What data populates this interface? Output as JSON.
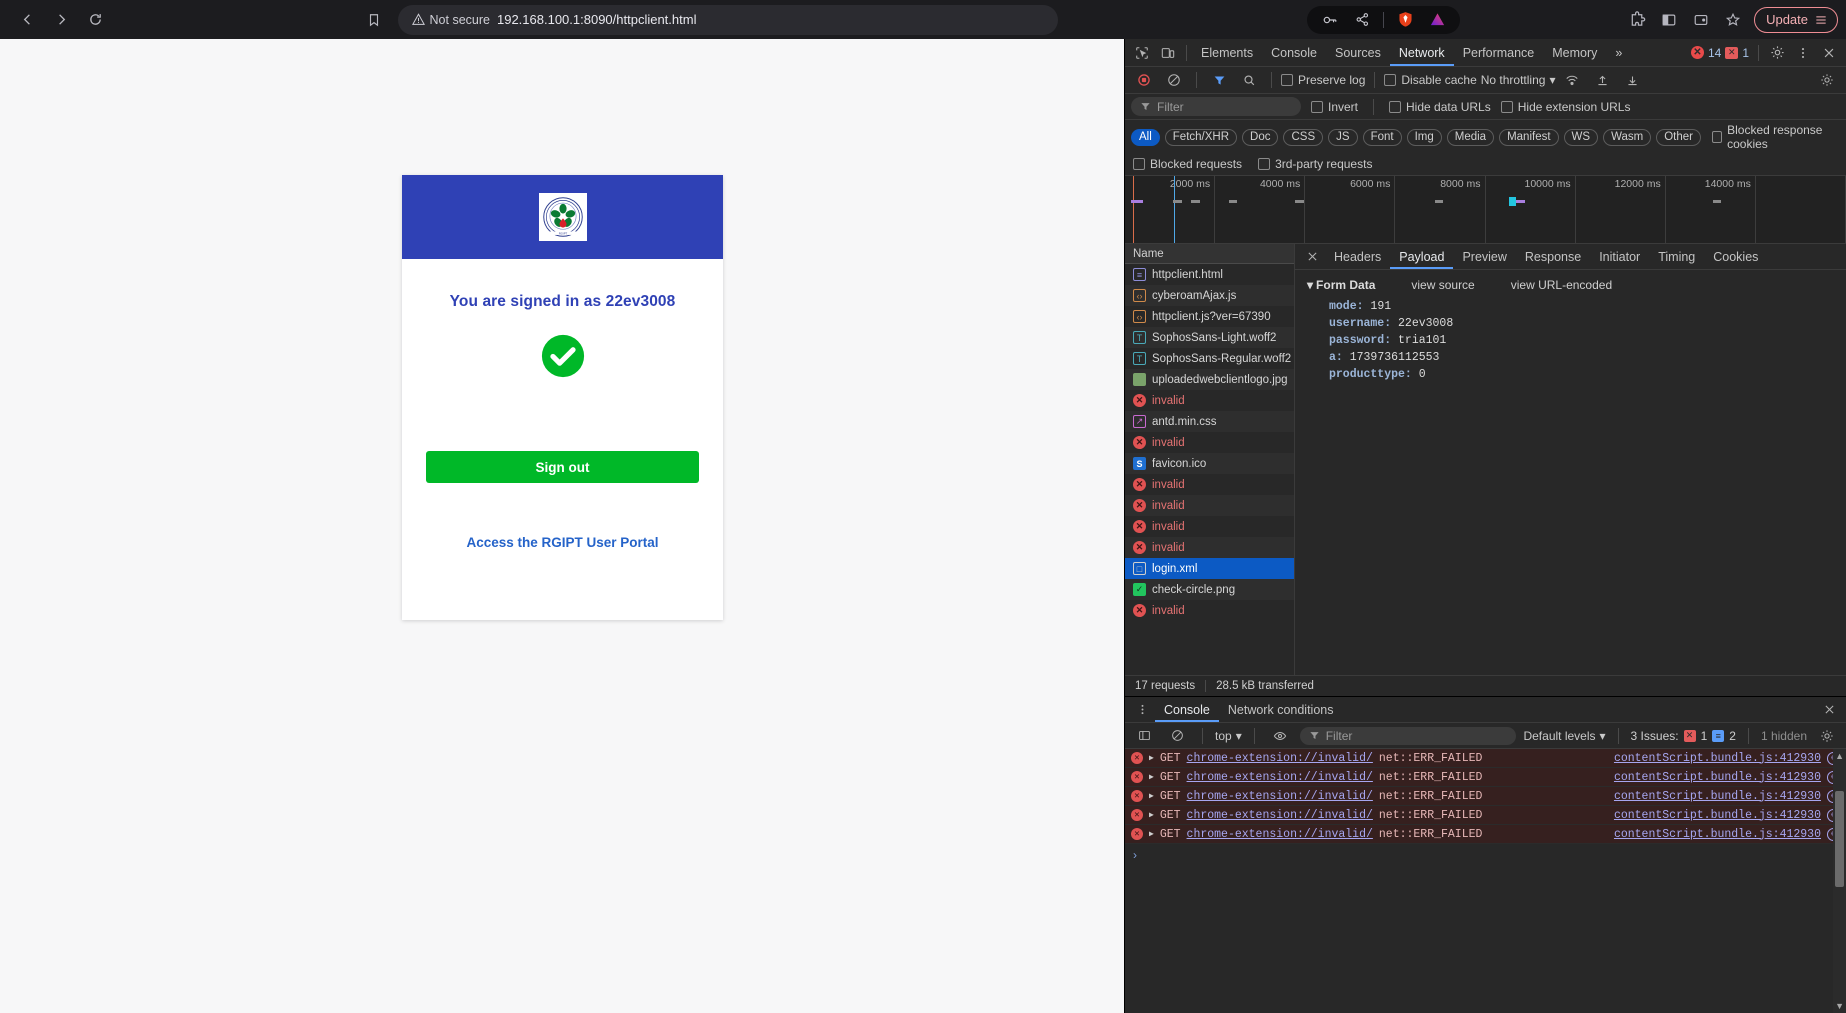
{
  "browser": {
    "back_icon": "back-arrow-icon",
    "forward_icon": "forward-arrow-icon",
    "reload_icon": "reload-icon",
    "bookmark_icon": "bookmark-icon",
    "security_label": "Not secure",
    "url": "192.168.100.1:8090/httpclient.html",
    "update_label": "Update",
    "toolbar_icons": [
      "password-key-icon",
      "share-icon",
      "brave-shield-icon",
      "leo-ai-icon",
      "extensions-icon",
      "sidebar-icon",
      "wallet-icon",
      "bookmark-star-icon",
      "menu-icon"
    ]
  },
  "page": {
    "signed_in_text": "You are signed in as 22ev3008",
    "signout_label": "Sign out",
    "portal_link": "Access the RGIPT User Portal",
    "logo_name": "rgipt-logo",
    "header_color": "#2f41b5",
    "button_color": "#00b828",
    "link_color": "#2563c9"
  },
  "devtools": {
    "tabs": [
      {
        "label": "Elements",
        "active": false
      },
      {
        "label": "Console",
        "active": false
      },
      {
        "label": "Sources",
        "active": false
      },
      {
        "label": "Network",
        "active": true
      },
      {
        "label": "Performance",
        "active": false
      },
      {
        "label": "Memory",
        "active": false
      }
    ],
    "more_tabs": "»",
    "error_count": "14",
    "warning_count": "1",
    "settings_icon": "gear-icon",
    "more_icon": "kebab-menu-icon",
    "close_icon": "close-icon",
    "inspect_icon": "inspect-element-icon",
    "device_icon": "device-toolbar-icon",
    "network": {
      "record_icon": "record-stop-icon",
      "clear_icon": "clear-requests-icon",
      "filter_icon": "filter-icon",
      "search_icon": "search-icon",
      "preserve_log": "Preserve log",
      "disable_cache": "Disable cache",
      "throttling": "No throttling",
      "wifi_icon": "network-conditions-icon",
      "import_icon": "import-har-icon",
      "export_icon": "export-har-icon",
      "settings_icon": "network-settings-icon",
      "filter_placeholder": "Filter",
      "invert": "Invert",
      "hide_data_urls": "Hide data URLs",
      "hide_extension_urls": "Hide extension URLs",
      "types": [
        "All",
        "Fetch/XHR",
        "Doc",
        "CSS",
        "JS",
        "Font",
        "Img",
        "Media",
        "Manifest",
        "WS",
        "Wasm",
        "Other"
      ],
      "active_type": "All",
      "blocked_response_cookies": "Blocked response cookies",
      "blocked_requests": "Blocked requests",
      "third_party_requests": "3rd-party requests",
      "timeline_ticks": [
        "2000 ms",
        "4000 ms",
        "6000 ms",
        "8000 ms",
        "10000 ms",
        "12000 ms",
        "14000 ms"
      ],
      "name_column": "Name",
      "requests": [
        {
          "name": "httpclient.html",
          "kind": "html",
          "glyph": "≡"
        },
        {
          "name": "cyberoamAjax.js",
          "kind": "js",
          "glyph": "‹›"
        },
        {
          "name": "httpclient.js?ver=67390",
          "kind": "js",
          "glyph": "‹›"
        },
        {
          "name": "SophosSans-Light.woff2",
          "kind": "font",
          "glyph": "T"
        },
        {
          "name": "SophosSans-Regular.woff2",
          "kind": "font",
          "glyph": "T"
        },
        {
          "name": "uploadedwebclientlogo.jpg",
          "kind": "img",
          "glyph": ""
        },
        {
          "name": "invalid",
          "kind": "err",
          "glyph": "✕"
        },
        {
          "name": "antd.min.css",
          "kind": "css",
          "glyph": "↗"
        },
        {
          "name": "invalid",
          "kind": "err",
          "glyph": "✕"
        },
        {
          "name": "favicon.ico",
          "kind": "ico",
          "glyph": "S"
        },
        {
          "name": "invalid",
          "kind": "err",
          "glyph": "✕"
        },
        {
          "name": "invalid",
          "kind": "err",
          "glyph": "✕"
        },
        {
          "name": "invalid",
          "kind": "err",
          "glyph": "✕"
        },
        {
          "name": "invalid",
          "kind": "err",
          "glyph": "✕"
        },
        {
          "name": "login.xml",
          "kind": "xml",
          "glyph": "□",
          "selected": true
        },
        {
          "name": "check-circle.png",
          "kind": "png",
          "glyph": "✓"
        },
        {
          "name": "invalid",
          "kind": "err",
          "glyph": "✕"
        }
      ],
      "status_requests": "17 requests",
      "status_transferred": "28.5 kB transferred"
    },
    "detail": {
      "close_icon": "close-detail-icon",
      "tabs": [
        {
          "label": "Headers",
          "active": false
        },
        {
          "label": "Payload",
          "active": true
        },
        {
          "label": "Preview",
          "active": false
        },
        {
          "label": "Response",
          "active": false
        },
        {
          "label": "Initiator",
          "active": false
        },
        {
          "label": "Timing",
          "active": false
        },
        {
          "label": "Cookies",
          "active": false
        }
      ],
      "form_data_title": "Form Data",
      "view_source": "view source",
      "view_url_encoded": "view URL-encoded",
      "fields": [
        {
          "key": "mode:",
          "value": "191"
        },
        {
          "key": "username:",
          "value": "22ev3008"
        },
        {
          "key": "password:",
          "value": "tria101"
        },
        {
          "key": "a:",
          "value": "1739736112553"
        },
        {
          "key": "producttype:",
          "value": "0"
        }
      ]
    },
    "drawer": {
      "menu_icon": "drawer-menu-icon",
      "tabs": [
        {
          "label": "Console",
          "active": true
        },
        {
          "label": "Network conditions",
          "active": false
        }
      ],
      "close_icon": "drawer-close-icon",
      "sidebar_icon": "console-sidebar-icon",
      "clear_icon": "clear-console-icon",
      "context": "top",
      "eye_icon": "live-expression-icon",
      "filter_icon": "filter-icon",
      "filter_placeholder": "Filter",
      "levels": "Default levels",
      "issues_label": "3 Issues:",
      "issues_error": "1",
      "issues_info": "2",
      "hidden_label": "1 hidden",
      "settings_icon": "console-settings-icon",
      "messages": [
        {
          "method": "GET",
          "url": "chrome-extension://invalid/",
          "error": "net::ERR_FAILED",
          "source": "contentScript.bundle.js:412930"
        },
        {
          "method": "GET",
          "url": "chrome-extension://invalid/",
          "error": "net::ERR_FAILED",
          "source": "contentScript.bundle.js:412930"
        },
        {
          "method": "GET",
          "url": "chrome-extension://invalid/",
          "error": "net::ERR_FAILED",
          "source": "contentScript.bundle.js:412930"
        },
        {
          "method": "GET",
          "url": "chrome-extension://invalid/",
          "error": "net::ERR_FAILED",
          "source": "contentScript.bundle.js:412930"
        },
        {
          "method": "GET",
          "url": "chrome-extension://invalid/",
          "error": "net::ERR_FAILED",
          "source": "contentScript.bundle.js:412930"
        }
      ],
      "prompt": "›"
    }
  }
}
